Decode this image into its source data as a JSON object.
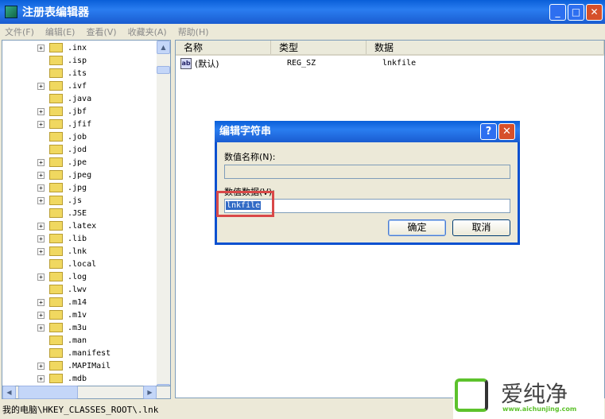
{
  "window": {
    "title": "注册表编辑器",
    "min": "_",
    "max": "□",
    "close": "✕"
  },
  "menu": [
    "文件(F)",
    "编辑(E)",
    "查看(V)",
    "收藏夹(A)",
    "帮助(H)"
  ],
  "tree": [
    {
      "label": ".inx",
      "expand": true
    },
    {
      "label": ".isp",
      "expand": false
    },
    {
      "label": ".its",
      "expand": false
    },
    {
      "label": ".ivf",
      "expand": true
    },
    {
      "label": ".java",
      "expand": false
    },
    {
      "label": ".jbf",
      "expand": true
    },
    {
      "label": ".jfif",
      "expand": true
    },
    {
      "label": ".job",
      "expand": false
    },
    {
      "label": ".jod",
      "expand": false
    },
    {
      "label": ".jpe",
      "expand": true
    },
    {
      "label": ".jpeg",
      "expand": true
    },
    {
      "label": ".jpg",
      "expand": true
    },
    {
      "label": ".js",
      "expand": true
    },
    {
      "label": ".JSE",
      "expand": false
    },
    {
      "label": ".latex",
      "expand": true
    },
    {
      "label": ".lib",
      "expand": true
    },
    {
      "label": ".lnk",
      "expand": true
    },
    {
      "label": ".local",
      "expand": false
    },
    {
      "label": ".log",
      "expand": true
    },
    {
      "label": ".lwv",
      "expand": false
    },
    {
      "label": ".m14",
      "expand": true
    },
    {
      "label": ".m1v",
      "expand": true
    },
    {
      "label": ".m3u",
      "expand": true
    },
    {
      "label": ".man",
      "expand": false
    },
    {
      "label": ".manifest",
      "expand": false
    },
    {
      "label": ".MAPIMail",
      "expand": true
    },
    {
      "label": ".mdb",
      "expand": true
    }
  ],
  "list": {
    "headers": [
      "名称",
      "类型",
      "数据"
    ],
    "rows": [
      {
        "name": "(默认)",
        "type": "REG_SZ",
        "data": "lnkfile",
        "icon": "ab"
      }
    ]
  },
  "status": "我的电脑\\HKEY_CLASSES_ROOT\\.lnk",
  "dialog": {
    "title": "编辑字符串",
    "help": "?",
    "close": "✕",
    "name_label": "数值名称(N):",
    "name_value": "",
    "data_label": "数值数据(V):",
    "data_value": "lnkfile",
    "ok": "确定",
    "cancel": "取消"
  },
  "watermark": {
    "text": "爱纯净",
    "url": "www.aichunjing.com"
  }
}
